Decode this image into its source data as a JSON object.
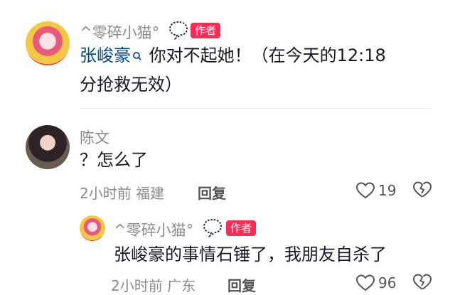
{
  "comments": [
    {
      "username": "^零碎小猫°",
      "badge": "作者",
      "mention": "张峻豪",
      "text_line1": " 你对不起她！（在今天的12:18",
      "text_line2": "分抢救无效）"
    },
    {
      "username": "陈文",
      "text": "？怎么了",
      "time": "2小时前",
      "location": "福建",
      "reply_label": "回复",
      "likes": "19"
    }
  ],
  "reply": {
    "username": "^零碎小猫°",
    "badge": "作者",
    "text": "张峻豪的事情石锤了，我朋友自杀了",
    "time": "2小时前",
    "location": "广东",
    "reply_label": "回复",
    "likes": "96"
  },
  "colors": {
    "author_badge": "#fe2c55",
    "mention": "#04498d",
    "meta_gray": "#8a8b91"
  },
  "icons": [
    "speech-bubble-icon",
    "search-tag-icon",
    "heart-icon",
    "broken-heart-icon"
  ]
}
